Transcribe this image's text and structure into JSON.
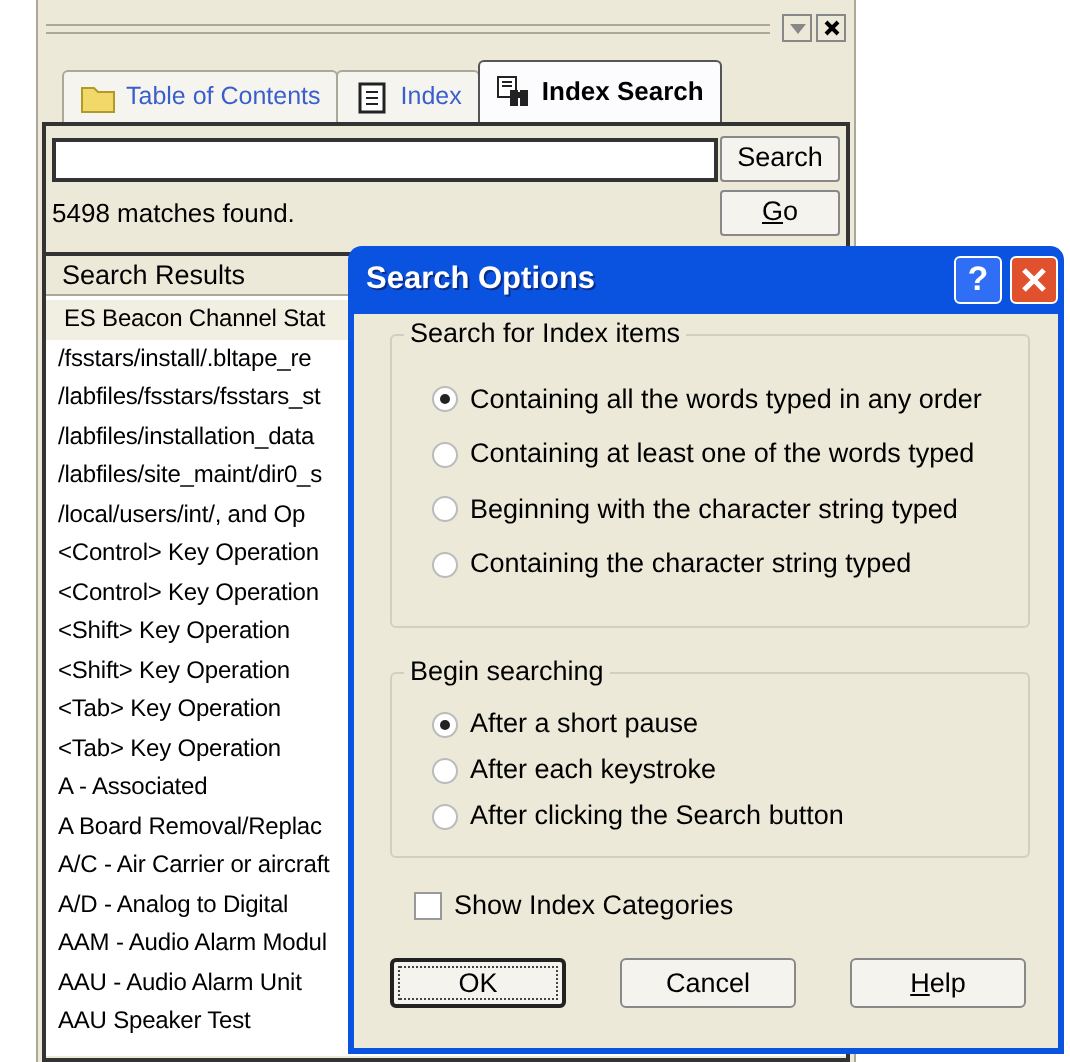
{
  "panel": {
    "tabs": [
      {
        "label": "Table of Contents",
        "selected": false,
        "kind": "folder"
      },
      {
        "label": "Index",
        "selected": false,
        "kind": "index"
      },
      {
        "label": "Index Search",
        "selected": true,
        "kind": "search"
      }
    ],
    "search_button": "Search",
    "status": "5498 matches found.",
    "go_button": "Go",
    "results": {
      "header": "Search Results",
      "items": [
        {
          "label": "ES Beacon Channel Stat",
          "selected": true
        },
        {
          "label": "/fsstars/install/.bltape_re",
          "selected": false
        },
        {
          "label": "/labfiles/fsstars/fsstars_st",
          "selected": false
        },
        {
          "label": "/labfiles/installation_data",
          "selected": false
        },
        {
          "label": "/labfiles/site_maint/dir0_s",
          "selected": false
        },
        {
          "label": "/local/users/int/, and Op",
          "selected": false
        },
        {
          "label": "<Control> Key Operation",
          "selected": false
        },
        {
          "label": "<Control> Key Operation",
          "selected": false
        },
        {
          "label": "<Shift> Key Operation",
          "selected": false
        },
        {
          "label": "<Shift> Key Operation",
          "selected": false
        },
        {
          "label": "<Tab> Key Operation",
          "selected": false
        },
        {
          "label": "<Tab> Key Operation",
          "selected": false
        },
        {
          "label": "A - Associated",
          "selected": false
        },
        {
          "label": "A Board Removal/Replac",
          "selected": false
        },
        {
          "label": "A/C - Air Carrier or aircraft",
          "selected": false
        },
        {
          "label": "A/D - Analog to Digital",
          "selected": false
        },
        {
          "label": "AAM - Audio Alarm Modul",
          "selected": false
        },
        {
          "label": "AAU - Audio Alarm Unit",
          "selected": false
        },
        {
          "label": "AAU Speaker Test",
          "selected": false
        }
      ]
    }
  },
  "dialog": {
    "title": "Search Options",
    "help_button": "?",
    "groups": [
      {
        "title": "Search for Index items",
        "options": [
          {
            "label": "Containing all the words typed in any order",
            "selected": true
          },
          {
            "label": "Containing at least one of the words typed",
            "selected": false
          },
          {
            "label": "Beginning with the character string typed",
            "selected": false
          },
          {
            "label": "Containing the character string typed",
            "selected": false
          }
        ]
      },
      {
        "title": "Begin searching",
        "options": [
          {
            "label": "After a short pause",
            "selected": true
          },
          {
            "label": "After each keystroke",
            "selected": false
          },
          {
            "label": "After clicking the Search button",
            "selected": false
          }
        ]
      }
    ],
    "checkbox": {
      "label": "Show Index Categories",
      "checked": false
    },
    "buttons": [
      {
        "label": "OK",
        "default": true,
        "underline_first": false
      },
      {
        "label": "Cancel",
        "default": false,
        "underline_first": false
      },
      {
        "label": "Help",
        "default": false,
        "underline_first": true
      }
    ]
  }
}
